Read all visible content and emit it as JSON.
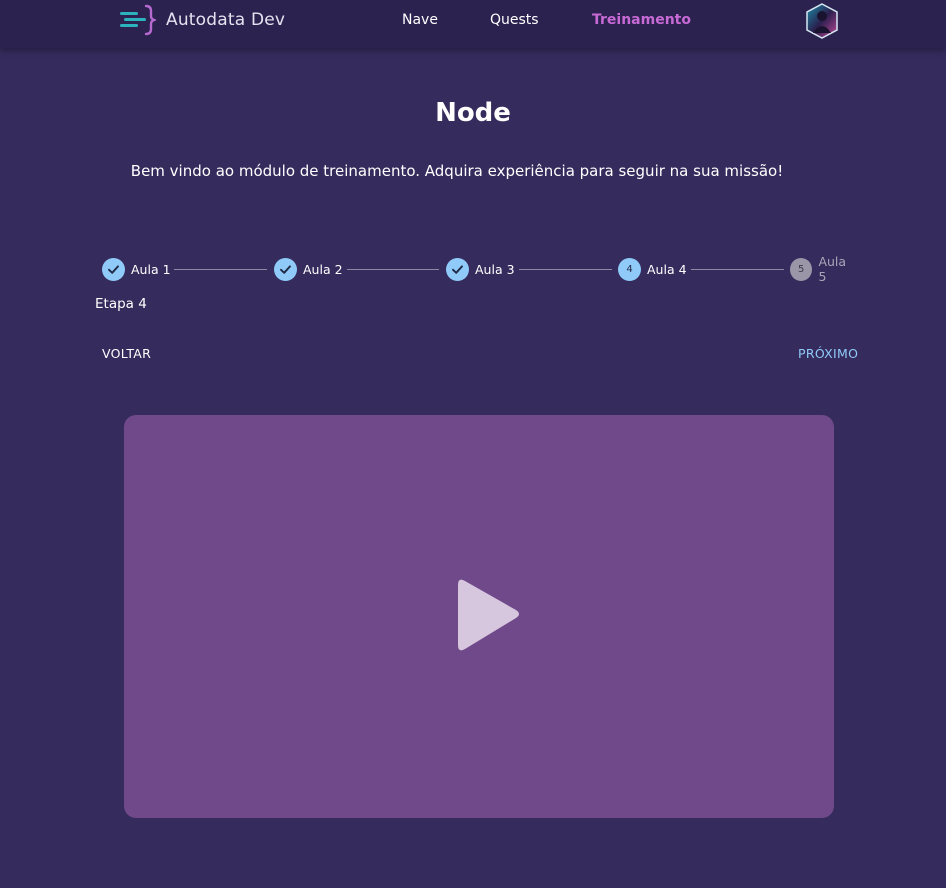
{
  "header": {
    "brand": "Autodata Dev",
    "nav": [
      {
        "label": "Nave",
        "active": false
      },
      {
        "label": "Quests",
        "active": false
      },
      {
        "label": "Treinamento",
        "active": true
      }
    ],
    "accent_color": "#c86ad6",
    "avatar_icon": "user-avatar-icon"
  },
  "main": {
    "title": "Node",
    "subtitle": "Bem vindo ao módulo de treinamento. Adquira experiência para seguir na sua missão!"
  },
  "stepper": {
    "steps": [
      {
        "label": "Aula 1",
        "status": "completed",
        "icon": "check-icon"
      },
      {
        "label": "Aula 2",
        "status": "completed",
        "icon": "check-icon"
      },
      {
        "label": "Aula 3",
        "status": "completed",
        "icon": "check-icon"
      },
      {
        "label": "Aula 4",
        "status": "active",
        "number": "4"
      },
      {
        "label": "Aula 5",
        "status": "pending",
        "number": "5"
      }
    ],
    "active_color": "#90caf9",
    "caption": "Etapa 4",
    "back_label": "VOLTAR",
    "next_label": "PRÓXIMO"
  },
  "video": {
    "background": "#70498a",
    "icon": "play-icon"
  }
}
